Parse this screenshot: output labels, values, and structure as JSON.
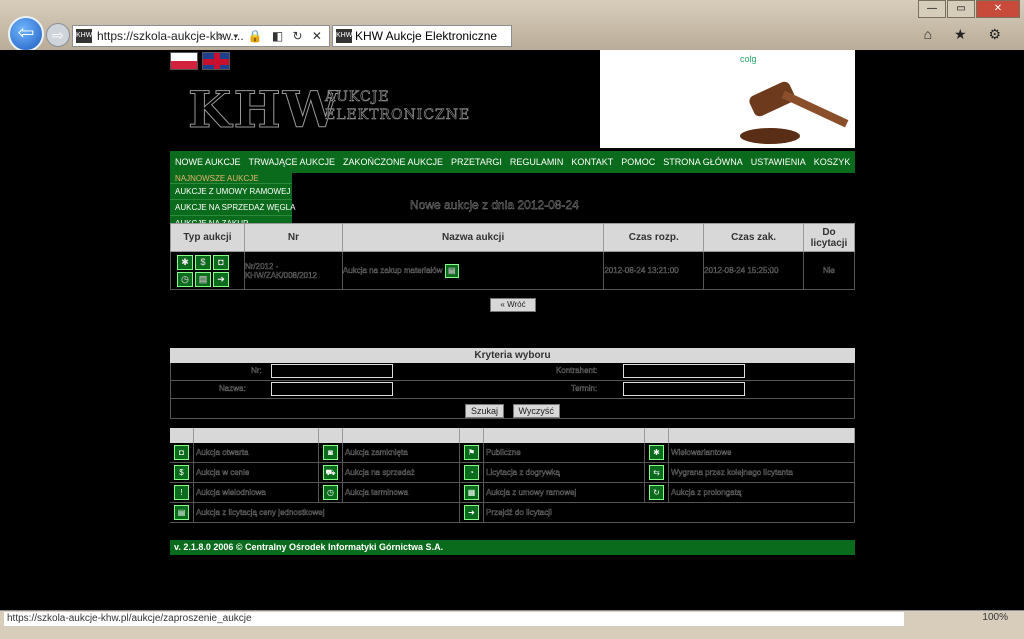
{
  "browser": {
    "address": "https://szkola-aukcje-khw....",
    "address_icons": "⌕ ▾ 🔒 ◧ ↻ ✕",
    "tab_title": "KHW Aukcje Elektroniczne",
    "favicon_text": "KHW",
    "toolbar_icons": "⌂ ★ ⚙",
    "status_url": "https://szkola-aukcje-khw.pl/aukcje/zaproszenie_aukcje",
    "zoom": "100%"
  },
  "header": {
    "logo": "KHW",
    "logo_sub_1": "AUKCJE",
    "logo_sub_2": "ELEKTRONICZNE",
    "hero_label": "colg"
  },
  "nav": {
    "items": [
      "NOWE AUKCJE",
      "TRWAJĄCE AUKCJE",
      "ZAKOŃCZONE AUKCJE",
      "PRZETARGI",
      "REGULAMIN",
      "KONTAKT",
      "POMOC",
      "STRONA GŁÓWNA",
      "USTAWIENIA",
      "KOSZYK"
    ],
    "dropdown": [
      "NAJNOWSZE AUKCJE",
      "AUKCJE Z UMOWY RAMOWEJ",
      "AUKCJE NA SPRZEDAŻ WĘGLA",
      "AUKCJE NA ZAKUP"
    ]
  },
  "section_title": "Nowe aukcje z dnia 2012-08-24",
  "table": {
    "headers": [
      "Typ aukcji",
      "Nr",
      "Nazwa aukcji",
      "Czas rozp.",
      "Czas zak.",
      "Do licytacji"
    ],
    "row": {
      "nr": "Nr/2012 - KHW/ZAK/008/2012",
      "name": "Aukcja na zakup materiałów",
      "start": "2012-08-24 13:21:00",
      "end": "2012-08-24 15:25:00",
      "status": "Nie"
    }
  },
  "back_button": "« Wróć",
  "criteria": {
    "title": "Kryteria wyboru",
    "labels": [
      "Nr:",
      "Kontrahent:",
      "Nazwa:",
      "Termin:"
    ],
    "search": "Szukaj",
    "clear": "Wyczyść"
  },
  "legend": [
    [
      "Aukcja otwarta",
      "Aukcja zamknięta",
      "Publiczne",
      "Wielowariantowe"
    ],
    [
      "Aukcja w cenie",
      "Aukcja na sprzedaż",
      "Licytacja z dogrywką",
      "Wygrana przez kolejnego licytanta"
    ],
    [
      "Aukcja wielodniowa",
      "Aukcja terminowa",
      "Aukcja z umowy ramowej",
      "Aukcja z prolongatą"
    ],
    [
      "Aukcja z licytacją ceny jednostkowej",
      "",
      "Przejdź do licytacji",
      ""
    ]
  ],
  "footer": "v. 2.1.8.0     2006 © Centralny Ośrodek Informatyki Górnictwa S.A."
}
